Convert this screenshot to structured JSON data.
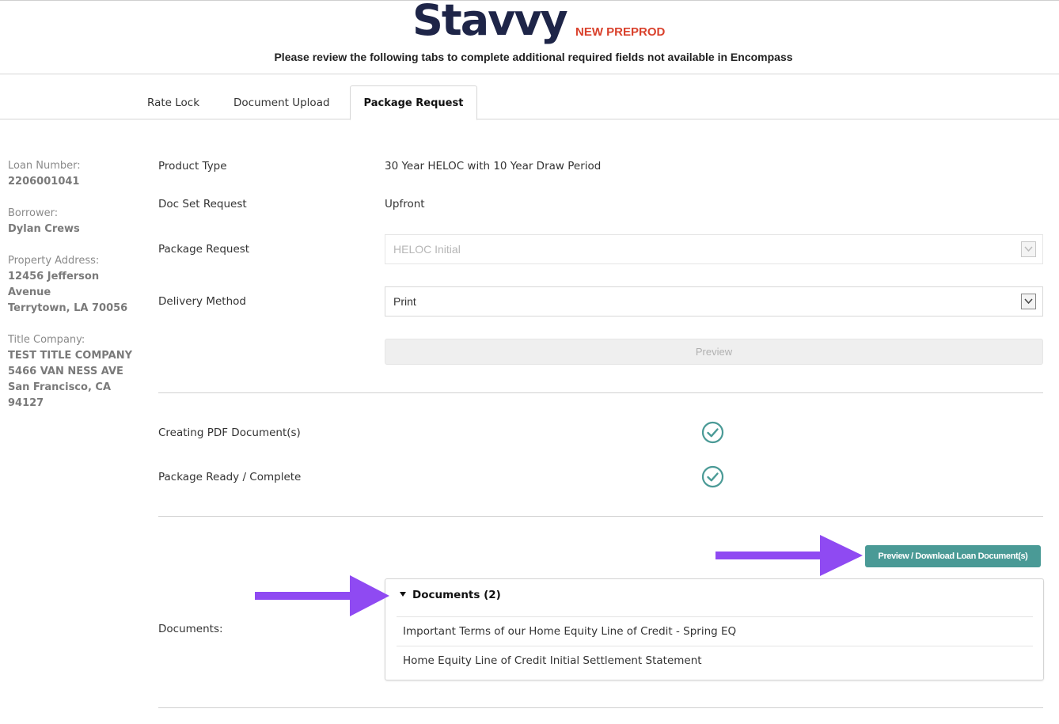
{
  "header": {
    "logo": "Stavvy",
    "environment": "NEW PREPROD",
    "subtitle": "Please review the following tabs to complete additional required fields not available in Encompass"
  },
  "tabs": [
    {
      "label": "Rate Lock",
      "active": false
    },
    {
      "label": "Document Upload",
      "active": false
    },
    {
      "label": "Package Request",
      "active": true
    }
  ],
  "sidebar": {
    "loan_number_label": "Loan Number:",
    "loan_number": "2206001041",
    "borrower_label": "Borrower:",
    "borrower": "Dylan Crews",
    "property_label": "Property Address:",
    "property_line1": "12456 Jefferson",
    "property_line2": "Avenue",
    "property_line3": "Terrytown, LA 70056",
    "title_label": "Title Company:",
    "title_line1": "TEST TITLE COMPANY",
    "title_line2": "5466 VAN NESS AVE",
    "title_line3": "San Francisco, CA",
    "title_line4": "94127"
  },
  "form": {
    "product_type_label": "Product Type",
    "product_type_value": "30 Year HELOC with 10 Year Draw Period",
    "doc_set_label": "Doc Set Request",
    "doc_set_value": "Upfront",
    "package_request_label": "Package Request",
    "package_request_value": "HELOC Initial",
    "delivery_method_label": "Delivery Method",
    "delivery_method_value": "Print",
    "preview_label": "Preview"
  },
  "status": {
    "creating_pdf_label": "Creating PDF Document(s)",
    "creating_pdf_done": true,
    "package_ready_label": "Package Ready / Complete",
    "package_ready_done": true
  },
  "documents": {
    "download_button": "Preview / Download Loan Document(s)",
    "section_label": "Documents:",
    "panel_title": "Documents (2)",
    "items": [
      "Important Terms of our Home Equity Line of Credit - Spring EQ",
      "Home Equity Line of Credit Initial Settlement Statement"
    ]
  },
  "colors": {
    "brand_navy": "#1e2548",
    "env_red": "#d9412c",
    "accent_teal": "#4a9a96",
    "annotation_purple": "#8f4af2"
  }
}
